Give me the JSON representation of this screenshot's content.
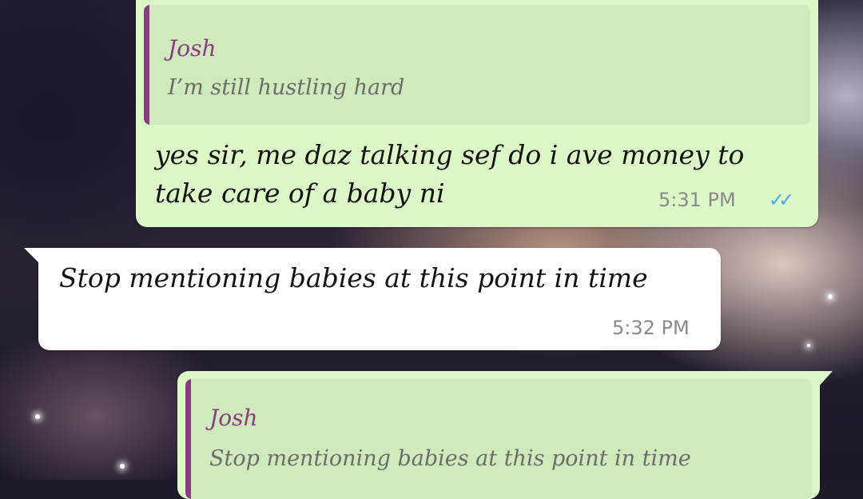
{
  "chat": {
    "messages": [
      {
        "direction": "outgoing",
        "quote": {
          "author": "Josh",
          "text": "I’m still hustling hard"
        },
        "text": "yes sir, me daz talking sef do i ave money to take care of a baby ni",
        "time": "5:31 PM",
        "status_icon": "double-check-read-icon",
        "status_glyph": "✓✓"
      },
      {
        "direction": "incoming",
        "text": "Stop mentioning babies at this point in time",
        "time": "5:32 PM"
      },
      {
        "direction": "outgoing",
        "quote": {
          "author": "Josh",
          "text": "Stop mentioning babies at this point in time"
        }
      }
    ]
  },
  "colors": {
    "outgoing_bubble": "#dcf8c6",
    "incoming_bubble": "#ffffff",
    "quote_accent": "#8b3a84",
    "read_ticks": "#4aa8e8"
  }
}
